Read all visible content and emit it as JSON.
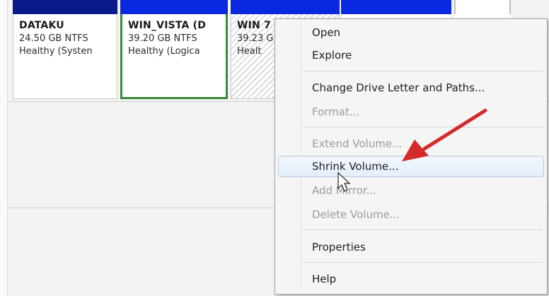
{
  "partitions": [
    {
      "name": "DATAKU",
      "size": "24.50 GB NTFS",
      "status": "Healthy (Systen"
    },
    {
      "name": "WIN_VISTA  (D",
      "size": "39.20 GB NTFS",
      "status": "Healthy (Logica"
    },
    {
      "name": "WIN 7",
      "size": "39.23 G",
      "status": "Healt"
    }
  ],
  "context_menu": {
    "items": [
      {
        "label": "Open",
        "enabled": true
      },
      {
        "label": "Explore",
        "enabled": true
      },
      {
        "label": "Change Drive Letter and Paths...",
        "enabled": true
      },
      {
        "label": "Format...",
        "enabled": false
      },
      {
        "label": "Extend Volume...",
        "enabled": false
      },
      {
        "label": "Shrink Volume...",
        "enabled": true,
        "highlighted": true
      },
      {
        "label": "Add Mirror...",
        "enabled": false
      },
      {
        "label": "Delete Volume...",
        "enabled": false
      },
      {
        "label": "Properties",
        "enabled": true
      },
      {
        "label": "Help",
        "enabled": true
      }
    ]
  },
  "colors": {
    "volume_bar_dark": "#0b1a8a",
    "volume_bar": "#0a28e0",
    "selection_border": "#3b8a3b",
    "annotation_arrow": "#d42a2a"
  },
  "icons": [
    "mouse-cursor-icon",
    "red-annotation-arrow-icon"
  ]
}
